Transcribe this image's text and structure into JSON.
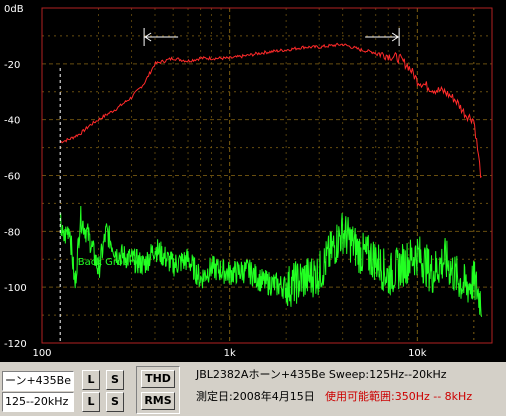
{
  "plot": {
    "y_tick_labels": [
      "0dB",
      "-20",
      "-40",
      "-60",
      "-80",
      "-100",
      "-120"
    ],
    "x_tick_labels": [
      "100",
      "1k",
      "10k"
    ],
    "annotation": "Back Ground",
    "colors": {
      "background": "#000000",
      "frame": "#b22222",
      "grid": "#8b6914",
      "response": "#ff2a2a",
      "background_noise": "#22ff22",
      "marker": "#ffffff"
    }
  },
  "chart_data": {
    "type": "line",
    "x_scale": "log",
    "xlim": [
      100,
      25000
    ],
    "ylim": [
      -120,
      0
    ],
    "y_unit": "dB",
    "x_unit": "Hz",
    "series": [
      {
        "name": "",
        "color": "#ff2a2a",
        "x": [
          125,
          140,
          160,
          180,
          200,
          250,
          300,
          350,
          400,
          500,
          600,
          700,
          800,
          1000,
          1250,
          1500,
          2000,
          2500,
          3000,
          4000,
          5000,
          6000,
          7000,
          8000,
          9000,
          10000,
          12000,
          14000,
          16000,
          18000,
          20000,
          22000
        ],
        "y": [
          -48,
          -47,
          -45,
          -42,
          -40,
          -36,
          -32,
          -27,
          -20,
          -18,
          -19,
          -18,
          -18,
          -18,
          -17,
          -16,
          -15,
          -14,
          -14,
          -13,
          -15,
          -16,
          -17,
          -18,
          -21,
          -26,
          -29,
          -30,
          -33,
          -38,
          -40,
          -62
        ]
      },
      {
        "name": "Back Ground",
        "color": "#22ff22",
        "x": [
          125,
          130,
          140,
          150,
          160,
          180,
          200,
          220,
          250,
          300,
          350,
          400,
          500,
          600,
          700,
          800,
          1000,
          1250,
          1500,
          2000,
          2500,
          3000,
          4000,
          5000,
          6000,
          7000,
          8000,
          10000,
          12000,
          14000,
          16000,
          18000,
          20000,
          22000
        ],
        "y": [
          -77,
          -83,
          -78,
          -100,
          -75,
          -83,
          -94,
          -80,
          -88,
          -90,
          -92,
          -86,
          -92,
          -90,
          -97,
          -93,
          -95,
          -94,
          -98,
          -100,
          -97,
          -95,
          -80,
          -88,
          -90,
          -96,
          -93,
          -88,
          -95,
          -90,
          -96,
          -100,
          -98,
          -105
        ]
      }
    ],
    "markers": {
      "vertical_dashed_x": [
        125
      ],
      "range_arrows_x": [
        350,
        8000
      ]
    }
  },
  "controls": {
    "model_field": "ーン+435Be",
    "range_field": "125--20kHz",
    "l1_label": "L",
    "s1_label": "S",
    "l2_label": "L",
    "s2_label": "S",
    "thd_label": "THD",
    "rms_label": "RMS"
  },
  "info": {
    "line1": "JBL2382Aホーン+435Be  Sweep:125Hz--20kHz",
    "line2_date": "測定日:2008年4月15日",
    "line2_range": "使用可能範囲:350Hz -- 8kHz",
    "range_color": "#cc0000"
  }
}
